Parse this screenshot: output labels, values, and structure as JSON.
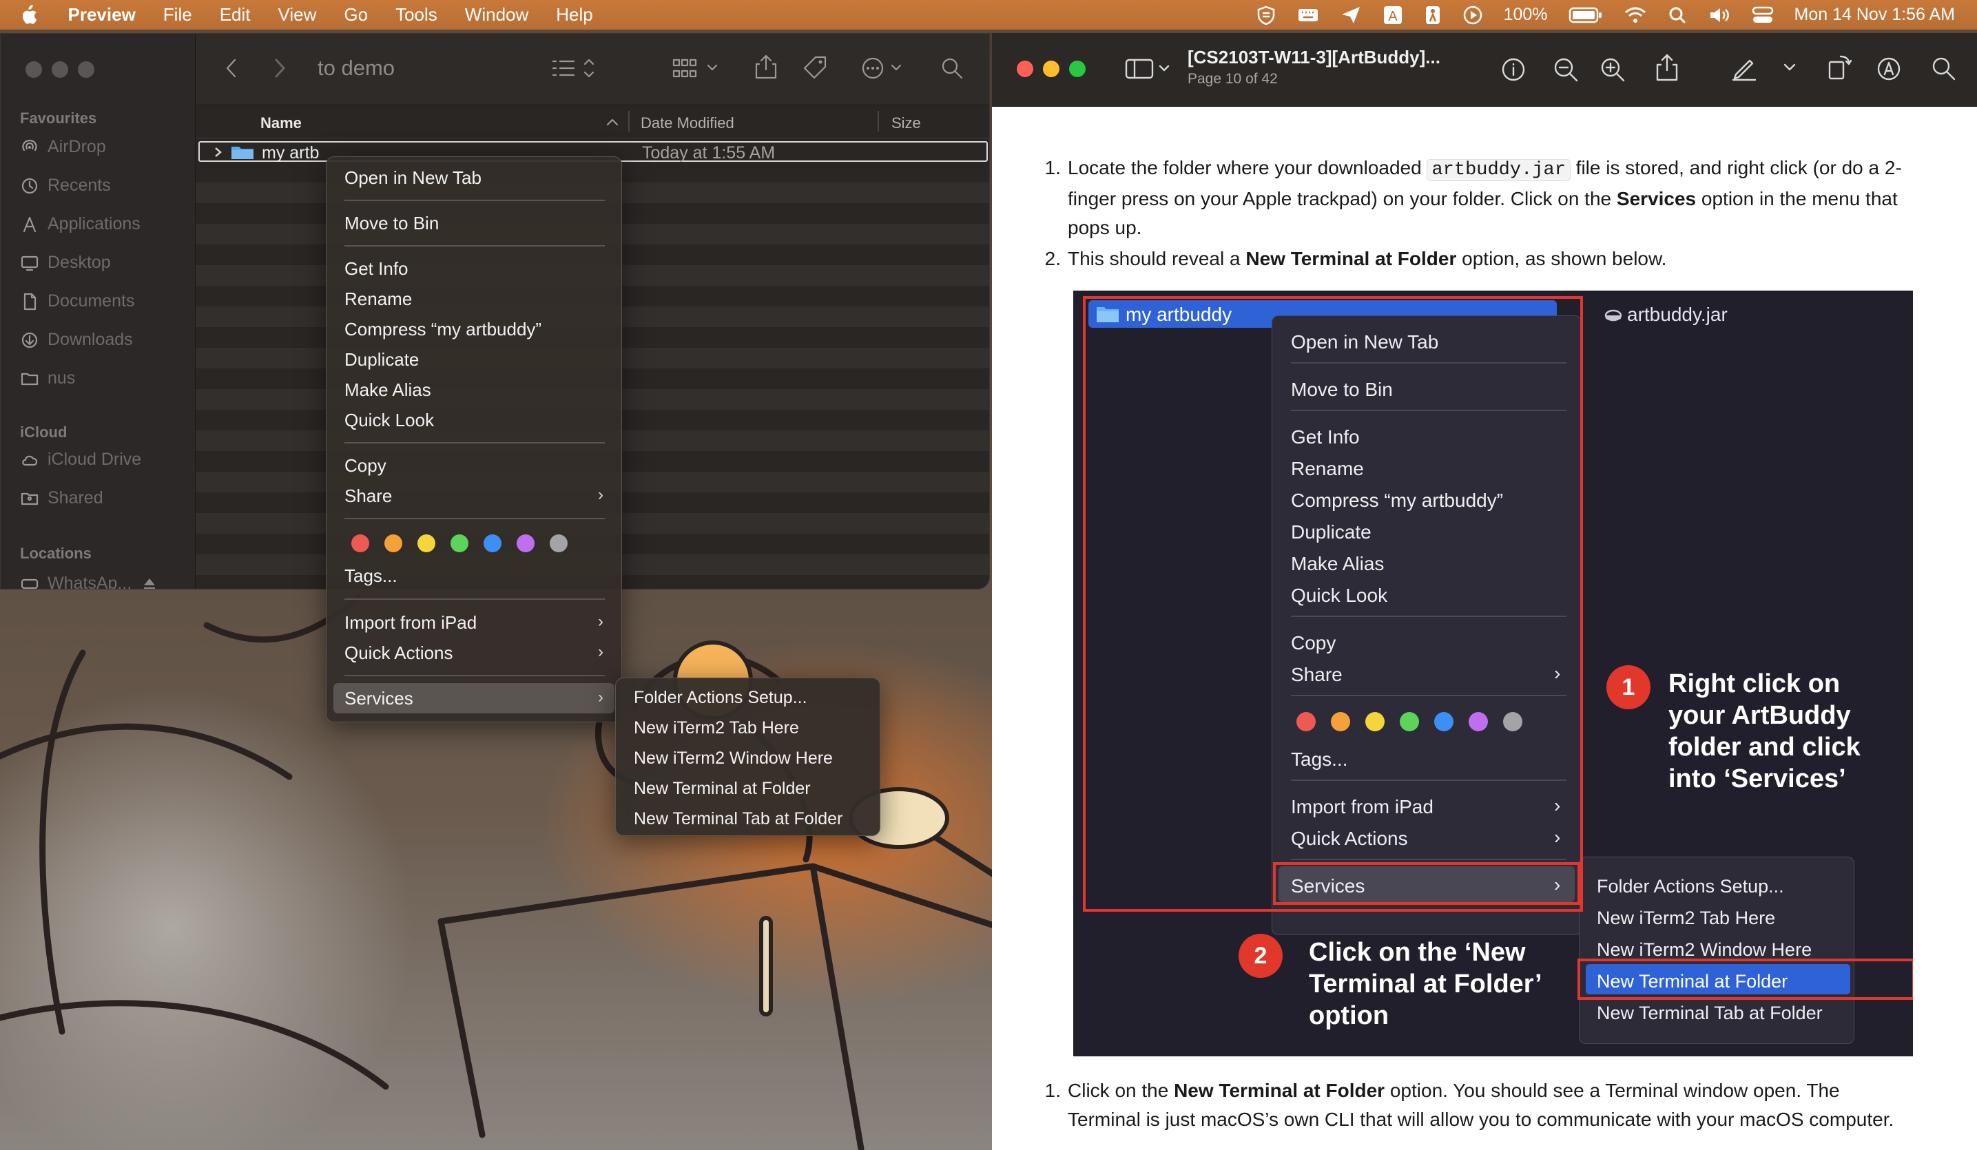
{
  "menubar": {
    "app_name": "Preview",
    "items": [
      "File",
      "Edit",
      "View",
      "Go",
      "Tools",
      "Window",
      "Help"
    ],
    "battery": "100%",
    "clock": "Mon 14 Nov  1:56 AM"
  },
  "finder": {
    "title": "to demo",
    "sidebar": {
      "favourites_header": "Favourites",
      "favourites": [
        "AirDrop",
        "Recents",
        "Applications",
        "Desktop",
        "Documents",
        "Downloads",
        "nus"
      ],
      "icloud_header": "iCloud",
      "icloud": [
        "iCloud Drive",
        "Shared"
      ],
      "locations_header": "Locations",
      "locations": [
        "WhatsAp..."
      ]
    },
    "columns": {
      "name": "Name",
      "date_modified": "Date Modified",
      "size": "Size"
    },
    "row": {
      "name": "my artb",
      "date": "Today at 1:55 AM"
    }
  },
  "context_menu": {
    "open_new_tab": "Open in New Tab",
    "move_to_bin": "Move to Bin",
    "get_info": "Get Info",
    "rename": "Rename",
    "compress": "Compress “my artbuddy”",
    "duplicate": "Duplicate",
    "make_alias": "Make Alias",
    "quick_look": "Quick Look",
    "copy": "Copy",
    "share": "Share",
    "tags": "Tags...",
    "import_ipad": "Import from iPad",
    "quick_actions": "Quick Actions",
    "services": "Services",
    "tag_colors": [
      "#ee5a52",
      "#f3a23a",
      "#f4d63b",
      "#5cd35a",
      "#3d8ff5",
      "#c06ef0",
      "#a4a4a6"
    ]
  },
  "services_menu": {
    "items": [
      "Folder Actions Setup...",
      "New iTerm2 Tab Here",
      "New iTerm2 Window Here",
      "New Terminal at Folder",
      "New Terminal Tab at Folder"
    ]
  },
  "preview": {
    "doc_title": "[CS2103T-W11-3][ArtBuddy]...",
    "page_info": "Page 10 of 42",
    "step1_num": "1.",
    "step1_a": "Locate the folder where your downloaded ",
    "step1_code": "artbuddy.jar",
    "step1_b": " file is stored, and right click (or do a 2-finger press on your Apple trackpad) on your folder. Click on the ",
    "step1_bold": "Services",
    "step1_c": " option in the menu that pops up.",
    "step2_num": "2.",
    "step2_a": "This should reveal a ",
    "step2_bold": "New Terminal at Folder",
    "step2_b": " option, as shown below.",
    "step3_num": "1.",
    "step3_a": "Click on the ",
    "step3_bold": "New Terminal at Folder",
    "step3_b": " option. You should see a Terminal window open. The Terminal is just macOS’s own CLI that will allow you to communicate with your macOS computer."
  },
  "embedded": {
    "folder_name": "my artbuddy",
    "jar_name": "artbuddy.jar",
    "badge1": "1",
    "callout1": "Right click on your ArtBuddy folder and click into ‘Services’",
    "badge2": "2",
    "callout2": "Click on the ‘New Terminal at Folder’ option"
  },
  "colors": {
    "menubar": "#c0743a",
    "selected_blue": "#2f62d6",
    "annotation_red": "#e0362c"
  }
}
